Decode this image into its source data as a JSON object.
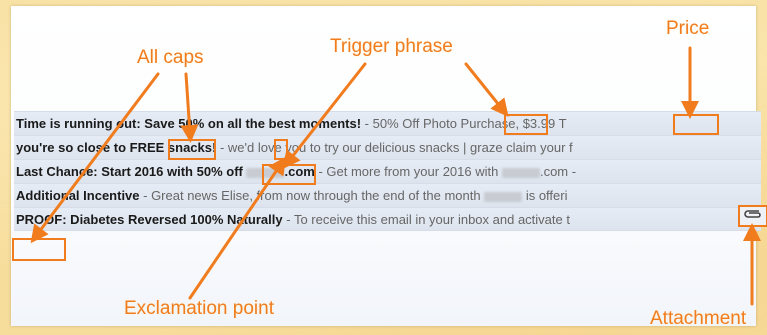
{
  "annotations": {
    "all_caps": "All caps",
    "trigger_phrase": "Trigger phrase",
    "price": "Price",
    "exclamation_point": "Exclamation point",
    "attachment": "Attachment"
  },
  "highlight_color": "#f07c1e",
  "emails": [
    {
      "subject_a": "Time is running out: Save 50% on all the best moments!",
      "snippet_a": " - 50",
      "hl_trigger": "% Off",
      "snippet_b": " Photo Purchase, ",
      "hl_price": "$3.99",
      "snippet_c": " T"
    },
    {
      "subject_a": "you're so close to ",
      "hl_caps": "FREE",
      "subject_b": " snacks",
      "hl_excl": "!",
      "snippet": " - we'd love you to try our delicious snacks | graze claim your f"
    },
    {
      "subject_a": "Last Chance: Start 2016 with ",
      "hl_trigger": "50% off",
      "subject_b": ".com",
      "snippet": " - Get more from your 2016 with ",
      "snippet_end": ".com -"
    },
    {
      "subject": "Additional Incentive",
      "snippet": " - Great news Elise, from now through the end of the month ",
      "snippet_end": " is offeri",
      "attachment_icon": "paperclip-icon"
    },
    {
      "hl_caps": "PROOF:",
      "subject": " Diabetes Reversed 100% Naturally",
      "snippet": " - To receive this email in your inbox and activate t"
    }
  ]
}
